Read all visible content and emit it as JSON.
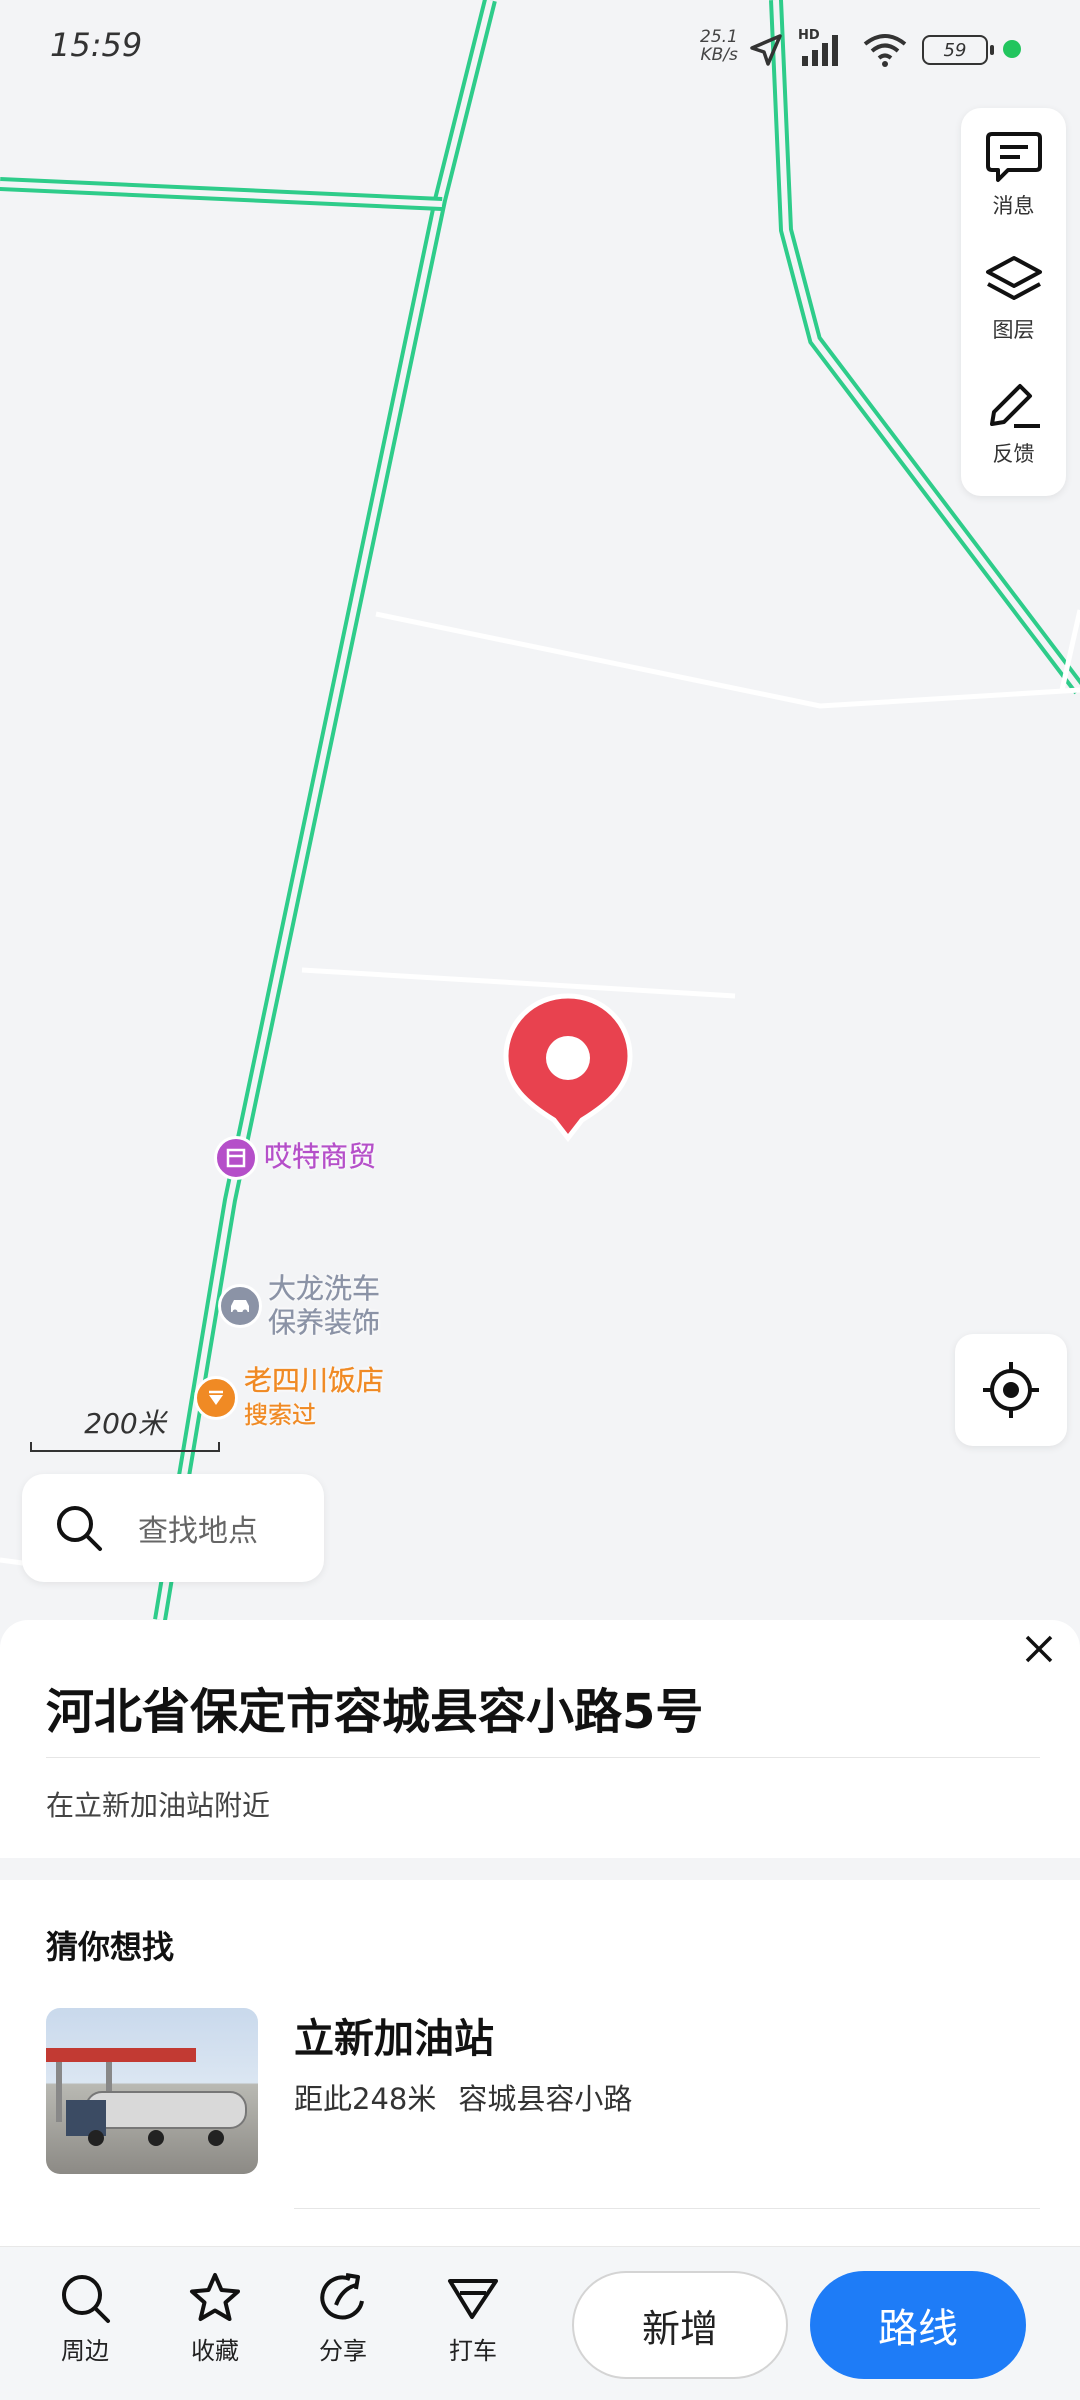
{
  "status_bar": {
    "time": "15:59",
    "net_speed": "25.1",
    "net_unit": "KB/s",
    "hd": "HD",
    "battery": "59",
    "battery_level": 0.59
  },
  "tools": [
    {
      "label": "消息",
      "icon": "message-icon"
    },
    {
      "label": "图层",
      "icon": "layers-icon"
    },
    {
      "label": "反馈",
      "icon": "feedback-edit-icon"
    }
  ],
  "pois": [
    {
      "name": "哎特商贸",
      "color": "#b54fc9",
      "icon": "shop-icon"
    },
    {
      "name_line1": "大龙洗车",
      "name_line2": "保养装饰",
      "color": "#8b93a6",
      "icon": "car-icon"
    },
    {
      "name_line1": "老四川饭店",
      "name_line2": "搜索过",
      "color": "#f08a24",
      "icon": "restaurant-icon"
    }
  ],
  "scale": "200米",
  "search": {
    "placeholder": "查找地点"
  },
  "sheet": {
    "address": "河北省保定市容城县容小路5号",
    "nearby": "在立新加油站附近",
    "guess_title": "猜你想找",
    "result": {
      "name": "立新加油站",
      "distance": "距此248米",
      "location": "容城县容小路"
    }
  },
  "bottom_nav": [
    {
      "label": "周边",
      "icon": "search-icon"
    },
    {
      "label": "收藏",
      "icon": "star-icon"
    },
    {
      "label": "分享",
      "icon": "share-icon"
    },
    {
      "label": "打车",
      "icon": "taxi-icon"
    }
  ],
  "buttons": {
    "add": "新增",
    "route": "路线"
  },
  "colors": {
    "road_green": "#2ecc8a",
    "pin_red": "#e8424f",
    "route_blue": "#1e7cf7"
  }
}
